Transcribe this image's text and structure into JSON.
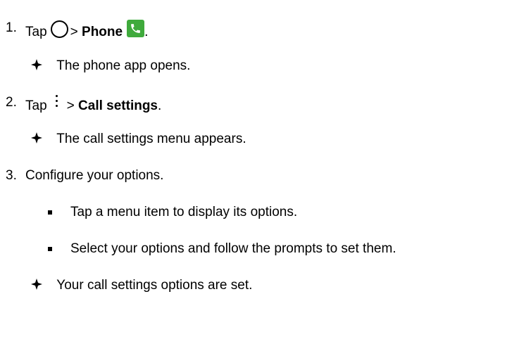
{
  "steps": [
    {
      "num": "1.",
      "text_before": "Tap",
      "text_mid": ">",
      "bold": "Phone",
      "text_after": ".",
      "home_icon": "home-circle-icon",
      "app_icon": "phone-app-icon"
    },
    {
      "num": "2.",
      "text_before": "Tap",
      "text_mid": ">",
      "bold": "Call settings",
      "text_after": ".",
      "menu_icon": "more-options-icon"
    },
    {
      "num": "3.",
      "text": "Configure your options."
    }
  ],
  "results": [
    "The phone app opens.",
    "The call settings menu appears.",
    "Your call settings options are set."
  ],
  "substeps": [
    "Tap a menu item to display its options.",
    "Select your options and follow the prompts to set them."
  ],
  "colors": {
    "phone_icon_bg": "#3faa3c",
    "text": "#000000"
  }
}
